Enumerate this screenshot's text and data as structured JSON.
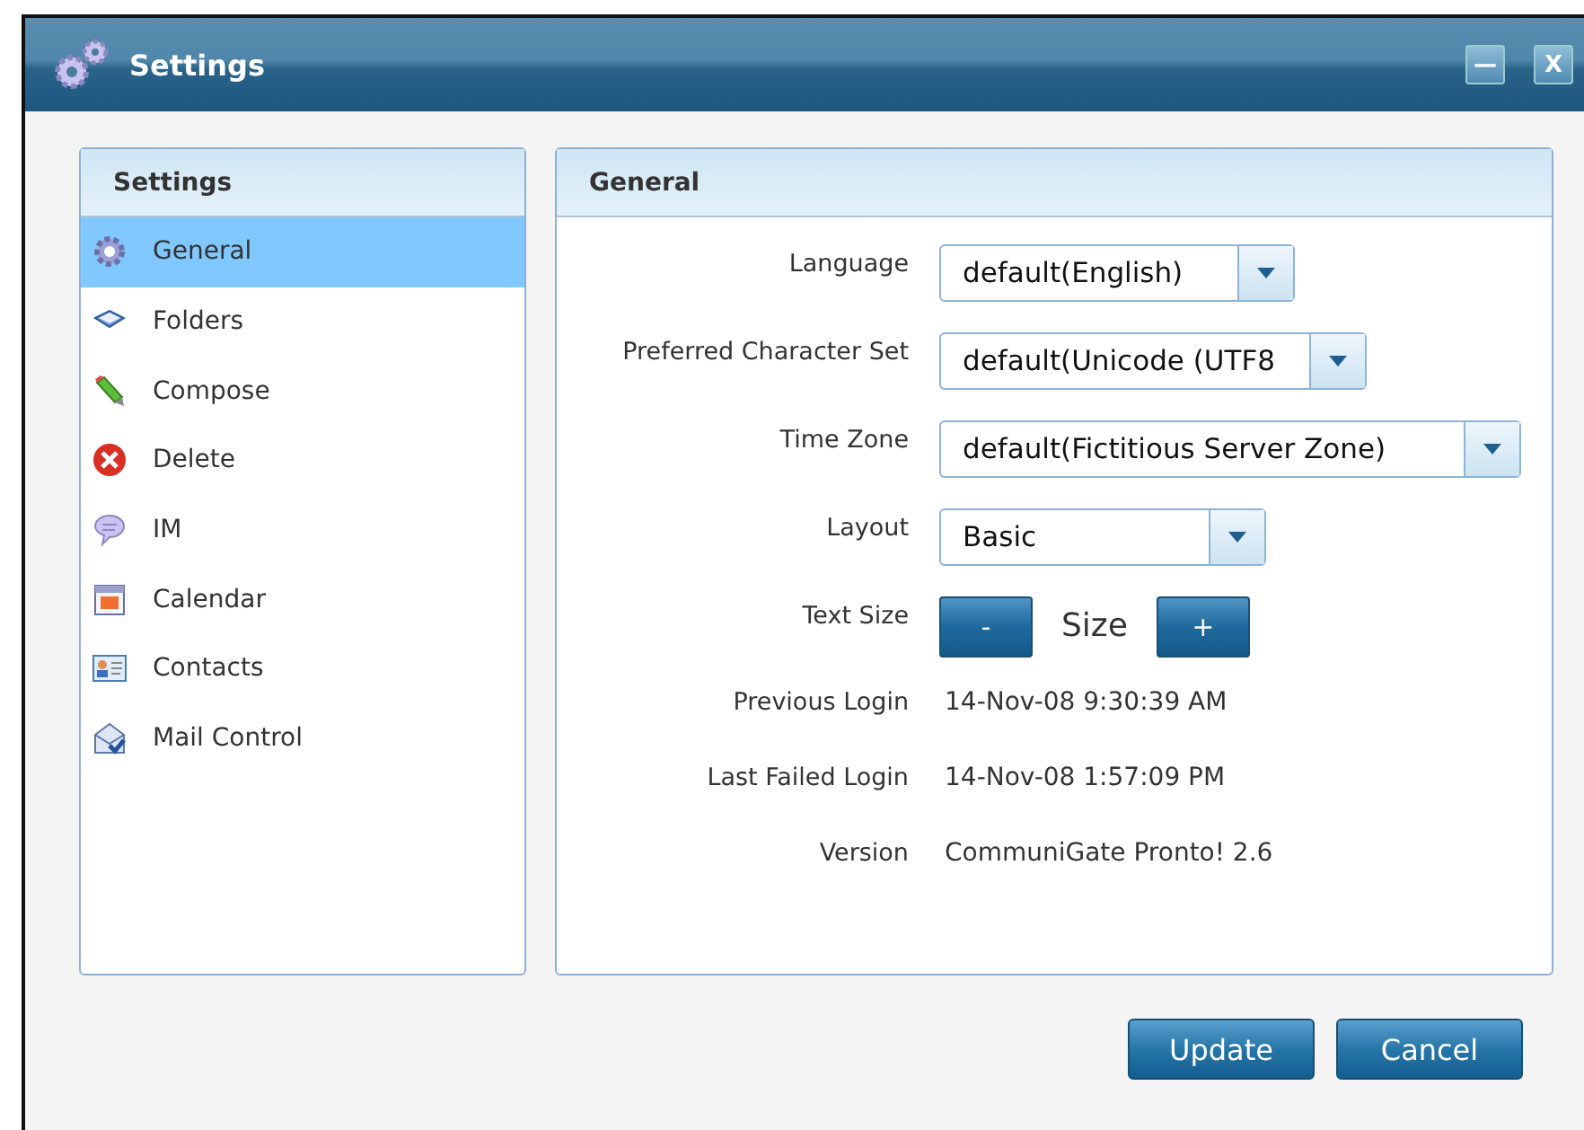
{
  "window": {
    "title": "Settings",
    "controls": [
      "—",
      "X"
    ]
  },
  "sidebar": {
    "title": "Settings",
    "items": [
      {
        "label": "General",
        "selected": true
      },
      {
        "label": "Folders",
        "selected": false
      },
      {
        "label": "Compose",
        "selected": false
      },
      {
        "label": "Delete",
        "selected": false
      },
      {
        "label": "IM",
        "selected": false
      },
      {
        "label": "Calendar",
        "selected": false
      },
      {
        "label": "Contacts",
        "selected": false
      },
      {
        "label": "Mail Control",
        "selected": false
      }
    ]
  },
  "panel": {
    "title": "General",
    "fields": [
      {
        "kind": "select",
        "label": "Language",
        "value": "default(English)"
      },
      {
        "kind": "select",
        "label": "Preferred Character Set",
        "value": "default(Unicode (UTF8"
      },
      {
        "kind": "select",
        "label": "Time Zone",
        "value": "default(Fictitious Server Zone)"
      },
      {
        "kind": "select",
        "label": "Layout",
        "value": "Basic"
      },
      {
        "kind": "stepper",
        "label": "Text Size",
        "minus": "-",
        "value": "Size",
        "plus": "+"
      },
      {
        "kind": "text",
        "label": "Previous Login",
        "value": "14-Nov-08 9:30:39 AM"
      },
      {
        "kind": "text",
        "label": "Last Failed Login",
        "value": "14-Nov-08 1:57:09 PM"
      },
      {
        "kind": "text",
        "label": "Version",
        "value": "CommuniGate Pronto! 2.6"
      }
    ]
  },
  "buttons": [
    "Update",
    "Cancel"
  ]
}
